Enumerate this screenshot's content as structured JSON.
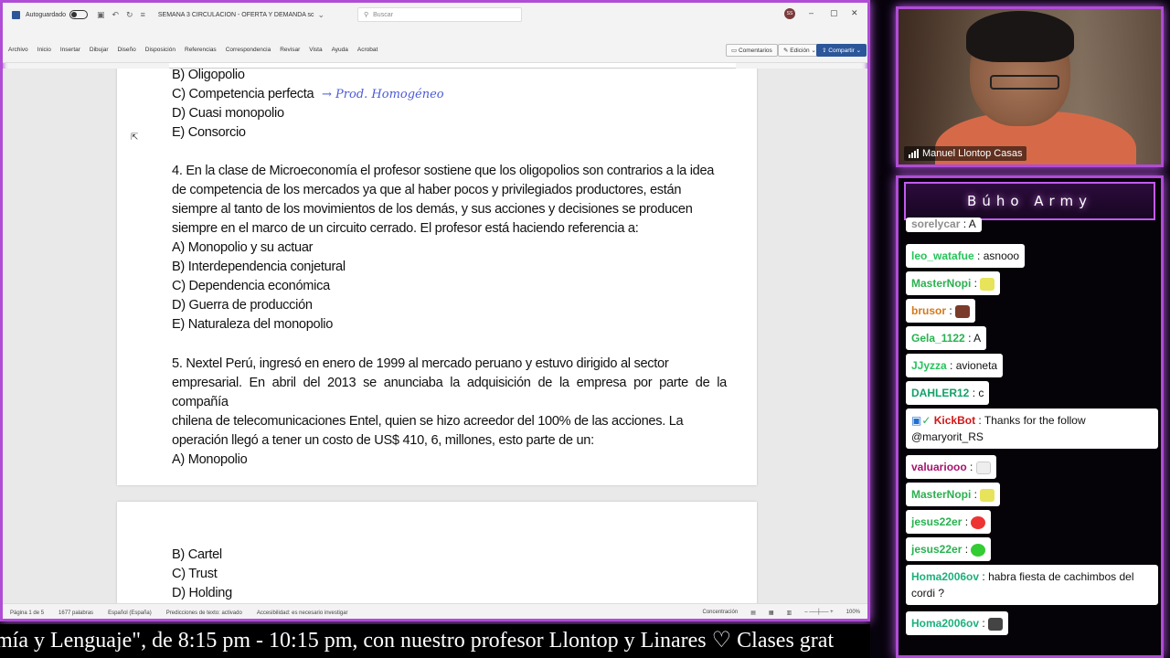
{
  "word": {
    "autosave_label": "Autoguardado",
    "doc_title": "SEMANA 3 CIRCULACION - OFERTA Y DEMANDA sc",
    "search_placeholder": "Buscar",
    "user_initials": "SS",
    "menu": [
      "Archivo",
      "Inicio",
      "Insertar",
      "Dibujar",
      "Diseño",
      "Disposición",
      "Referencias",
      "Correspondencia",
      "Revisar",
      "Vista",
      "Ayuda",
      "Acrobat"
    ],
    "btn_comments": "Comentarios",
    "btn_edit": "Edición",
    "btn_share": "Compartir",
    "status": {
      "page": "Página 1 de 5",
      "words": "1677 palabras",
      "lang": "Español (España)",
      "predictions": "Predicciones de texto: activado",
      "accessibility": "Accesibilidad: es necesario investigar",
      "focus": "Concentración",
      "zoom": "100%"
    }
  },
  "document": {
    "q3_options": [
      "B) Oligopolio",
      "C) Competencia perfecta",
      "D) Cuasi monopolio",
      "E) Consorcio"
    ],
    "annotation": "→  Prod. Homogéneo",
    "q4_lines": [
      "4. En la clase de Microeconomía el profesor sostiene que los oligopolios son contrarios a la idea",
      "de competencia de los mercados ya que al haber pocos y privilegiados productores, están",
      "siempre al tanto de los movimientos de los demás, y sus acciones y decisiones se producen",
      "siempre en el marco de un circuito cerrado. El profesor está haciendo referencia a:"
    ],
    "q4_options": [
      "A) Monopolio y su actuar",
      "B) Interdependencia conjetural",
      "C) Dependencia económica",
      "D) Guerra de producción",
      "E) Naturaleza del monopolio"
    ],
    "q5_lines": [
      "5. Nextel Perú, ingresó en enero de 1999 al mercado peruano y estuvo dirigido al sector",
      "empresarial. En abril del 2013 se anunciaba la adquisición de la empresa por parte de la compañía",
      "chilena de telecomunicaciones Entel, quien se hizo acreedor del 100% de las acciones. La",
      "operación llegó a tener un costo de US$ 410, 6, millones, esto parte de un:"
    ],
    "q5_option_a": "A) Monopolio",
    "q5_options_page2": [
      "B) Cartel",
      "C) Trust",
      "D) Holding"
    ]
  },
  "ticker": "mía y Lenguaje\", de 8:15 pm - 10:15 pm, con nuestro profesor Llontop y Linares  ♡    Clases grat",
  "webcam": {
    "name": "Manuel Llontop Casas"
  },
  "chat": {
    "title": "Búho Army",
    "messages": [
      {
        "user": "sorelycar",
        "text": "A"
      },
      {
        "user": "leo_watafue",
        "text": "asnooo"
      },
      {
        "user": "MasterNopi",
        "text": ""
      },
      {
        "user": "brusor",
        "text": ""
      },
      {
        "user": "Gela_1122",
        "text": "A"
      },
      {
        "user": "JJyzza",
        "text": "avioneta"
      },
      {
        "user": "DAHLER12",
        "text": "c"
      },
      {
        "user": "KickBot",
        "text": "Thanks for the follow @maryorit_RS"
      },
      {
        "user": "valuariooo",
        "text": ""
      },
      {
        "user": "MasterNopi",
        "text": ""
      },
      {
        "user": "jesus22er",
        "text": ""
      },
      {
        "user": "jesus22er",
        "text": ""
      },
      {
        "user": "Homa2006ov",
        "text": "habra fiesta de cachimbos del cordi ?"
      },
      {
        "user": "Homa2006ov",
        "text": ""
      }
    ]
  }
}
